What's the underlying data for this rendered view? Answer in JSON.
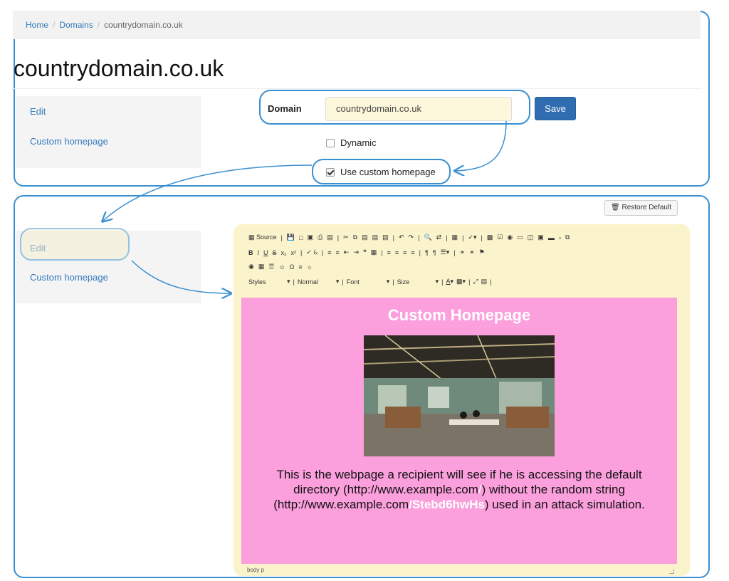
{
  "breadcrumb": {
    "home": "Home",
    "sep1": "/",
    "domains": "Domains",
    "sep2": "/",
    "current": "countrydomain.co.uk"
  },
  "page_title": "countrydomain.co.uk",
  "nav": {
    "edit": "Edit",
    "custom": "Custom homepage"
  },
  "form": {
    "domain_label": "Domain",
    "domain_value": "countrydomain.co.uk",
    "save_label": "Save",
    "dynamic_label": "Dynamic",
    "dynamic_checked": false,
    "custom_label": "Use custom homepage",
    "custom_checked": true
  },
  "restore": {
    "label": "Restore Default"
  },
  "editor": {
    "row1": [
      "Source",
      "|",
      "Save",
      "New",
      "Preview",
      "Print",
      "Templates",
      "|",
      "Cut",
      "Copy",
      "Paste",
      "Paste text",
      "Paste Word",
      "|",
      "Undo",
      "Redo",
      "|",
      "Find",
      "Replace",
      "|",
      "Select all",
      "|",
      "Spell",
      "|",
      "Form",
      "Checkbox",
      "Radio",
      "Text field",
      "Textarea",
      "Select",
      "Button",
      "Image button",
      "Hidden field"
    ],
    "row2": [
      "B",
      "I",
      "U",
      "S",
      "x₂",
      "x²",
      "|",
      "Remove format",
      "|",
      "Numbered list",
      "Bulleted list",
      "Outdent",
      "Indent",
      "Blockquote",
      "Div",
      "|",
      "Align left",
      "Center",
      "Align right",
      "Justify",
      "|",
      "LTR",
      "RTL",
      "Language",
      "|",
      "Link",
      "Unlink",
      "Anchor"
    ],
    "row3": [
      "Image",
      "Table",
      "Horizontal line",
      "Smiley",
      "Ω",
      "Page break",
      "Iframe"
    ],
    "row4": {
      "styles": "Styles",
      "format": "Normal",
      "font": "Font",
      "size": "Size"
    },
    "heading": "Custom Homepage",
    "body_t1": "This is the webpage a recipient will see if he is accessing the default directory (http://www.example.com",
    "body_slash": "/",
    "body_t2": ") without the random string (http://www.example.com",
    "body_rand": "/Stebd6hwHs",
    "body_t3": ") used in an attack simulation.",
    "status": "body  p"
  },
  "colors": {
    "accent": "#3a8fd0",
    "save": "#2f6db0",
    "editor_bg": "#fb9fdd",
    "toolbar_bg": "#fbf3cc"
  }
}
